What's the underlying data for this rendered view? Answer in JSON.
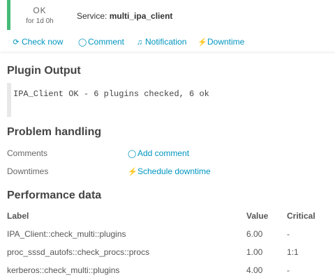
{
  "header": {
    "state_label": "OK",
    "state_since": "for 1d 0h",
    "service_prefix": "Service:",
    "service_name": "multi_ipa_client"
  },
  "actions": [
    {
      "label": "Check now",
      "icon": "refresh-icon"
    },
    {
      "label": "Comment",
      "icon": "comment-icon"
    },
    {
      "label": "Notification",
      "icon": "bell-icon"
    },
    {
      "label": "Downtime",
      "icon": "plug-icon"
    }
  ],
  "plugin_output": {
    "title": "Plugin Output",
    "text": "IPA_Client OK - 6 plugins checked, 6 ok"
  },
  "problem_handling": {
    "title": "Problem handling",
    "rows": [
      {
        "label": "Comments",
        "link": "Add comment",
        "icon": "comment-icon"
      },
      {
        "label": "Downtimes",
        "link": "Schedule downtime",
        "icon": "plug-icon"
      }
    ]
  },
  "performance": {
    "title": "Performance data",
    "headers": [
      "Label",
      "Value",
      "Critical"
    ],
    "rows": [
      [
        "IPA_Client::check_multi::plugins",
        "6.00",
        "-"
      ],
      [
        "proc_sssd_autofs::check_procs::procs",
        "1.00",
        "1:1"
      ],
      [
        "kerberos::check_multi::plugins",
        "4.00",
        "-"
      ]
    ]
  },
  "colors": {
    "ok": "#44bb77",
    "link": "#0095bf"
  }
}
